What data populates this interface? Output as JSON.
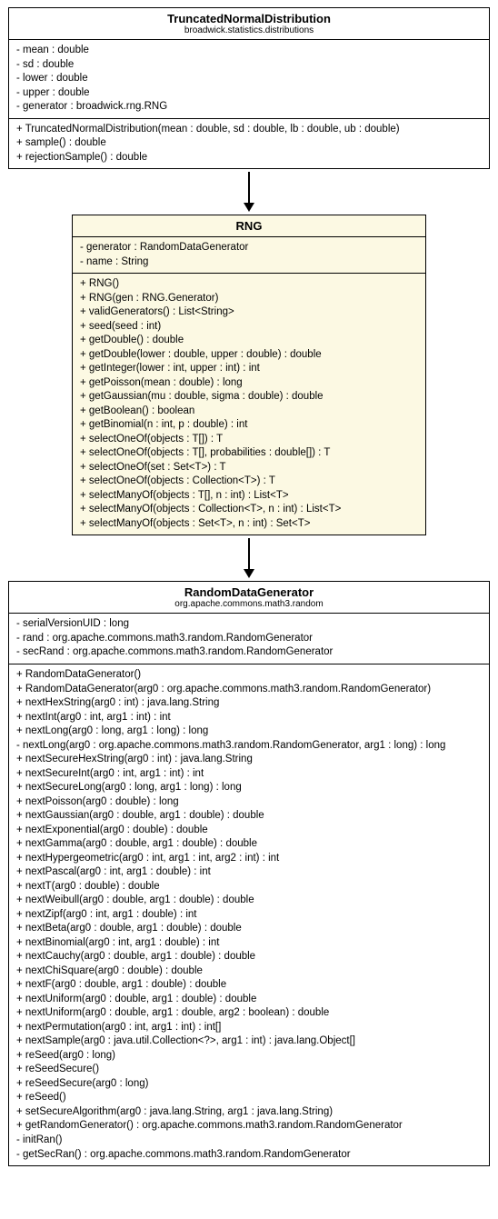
{
  "classes": {
    "truncated": {
      "name": "TruncatedNormalDistribution",
      "package": "broadwick.statistics.distributions",
      "attrs": [
        "- mean : double",
        "- sd : double",
        "- lower : double",
        "- upper : double",
        "- generator : broadwick.rng.RNG"
      ],
      "ops": [
        "+ TruncatedNormalDistribution(mean : double, sd : double, lb : double, ub : double)",
        "+ sample() : double",
        "+ rejectionSample() : double"
      ]
    },
    "rng": {
      "name": "RNG",
      "package": "",
      "attrs": [
        "- generator : RandomDataGenerator",
        "- name : String"
      ],
      "ops": [
        "+ RNG()",
        "+ RNG(gen : RNG.Generator)",
        "+ validGenerators() : List<String>",
        "+ seed(seed : int)",
        "+ getDouble() : double",
        "+ getDouble(lower : double, upper : double) : double",
        "+ getInteger(lower : int, upper : int) : int",
        "+ getPoisson(mean : double) : long",
        "+ getGaussian(mu : double, sigma : double) : double",
        "+ getBoolean() : boolean",
        "+ getBinomial(n : int, p : double) : int",
        "+ selectOneOf(objects : T[]) : T",
        "+ selectOneOf(objects : T[], probabilities : double[]) : T",
        "+ selectOneOf(set : Set<T>) : T",
        "+ selectOneOf(objects : Collection<T>) : T",
        "+ selectManyOf(objects : T[], n : int) : List<T>",
        "+ selectManyOf(objects : Collection<T>, n : int) : List<T>",
        "+ selectManyOf(objects : Set<T>, n : int) : Set<T>"
      ]
    },
    "rdg": {
      "name": "RandomDataGenerator",
      "package": "org.apache.commons.math3.random",
      "attrs": [
        "- serialVersionUID : long",
        "- rand : org.apache.commons.math3.random.RandomGenerator",
        "- secRand : org.apache.commons.math3.random.RandomGenerator"
      ],
      "ops": [
        "+ RandomDataGenerator()",
        "+ RandomDataGenerator(arg0 : org.apache.commons.math3.random.RandomGenerator)",
        "+ nextHexString(arg0 : int) : java.lang.String",
        "+ nextInt(arg0 : int, arg1 : int) : int",
        "+ nextLong(arg0 : long, arg1 : long) : long",
        "- nextLong(arg0 : org.apache.commons.math3.random.RandomGenerator, arg1 : long) : long",
        "+ nextSecureHexString(arg0 : int) : java.lang.String",
        "+ nextSecureInt(arg0 : int, arg1 : int) : int",
        "+ nextSecureLong(arg0 : long, arg1 : long) : long",
        "+ nextPoisson(arg0 : double) : long",
        "+ nextGaussian(arg0 : double, arg1 : double) : double",
        "+ nextExponential(arg0 : double) : double",
        "+ nextGamma(arg0 : double, arg1 : double) : double",
        "+ nextHypergeometric(arg0 : int, arg1 : int, arg2 : int) : int",
        "+ nextPascal(arg0 : int, arg1 : double) : int",
        "+ nextT(arg0 : double) : double",
        "+ nextWeibull(arg0 : double, arg1 : double) : double",
        "+ nextZipf(arg0 : int, arg1 : double) : int",
        "+ nextBeta(arg0 : double, arg1 : double) : double",
        "+ nextBinomial(arg0 : int, arg1 : double) : int",
        "+ nextCauchy(arg0 : double, arg1 : double) : double",
        "+ nextChiSquare(arg0 : double) : double",
        "+ nextF(arg0 : double, arg1 : double) : double",
        "+ nextUniform(arg0 : double, arg1 : double) : double",
        "+ nextUniform(arg0 : double, arg1 : double, arg2 : boolean) : double",
        "+ nextPermutation(arg0 : int, arg1 : int) : int[]",
        "+ nextSample(arg0 : java.util.Collection<?>, arg1 : int) : java.lang.Object[]",
        "+ reSeed(arg0 : long)",
        "+ reSeedSecure()",
        "+ reSeedSecure(arg0 : long)",
        "+ reSeed()",
        "+ setSecureAlgorithm(arg0 : java.lang.String, arg1 : java.lang.String)",
        "+ getRandomGenerator() : org.apache.commons.math3.random.RandomGenerator",
        "- initRan()",
        "- getSecRan() : org.apache.commons.math3.random.RandomGenerator"
      ]
    }
  }
}
